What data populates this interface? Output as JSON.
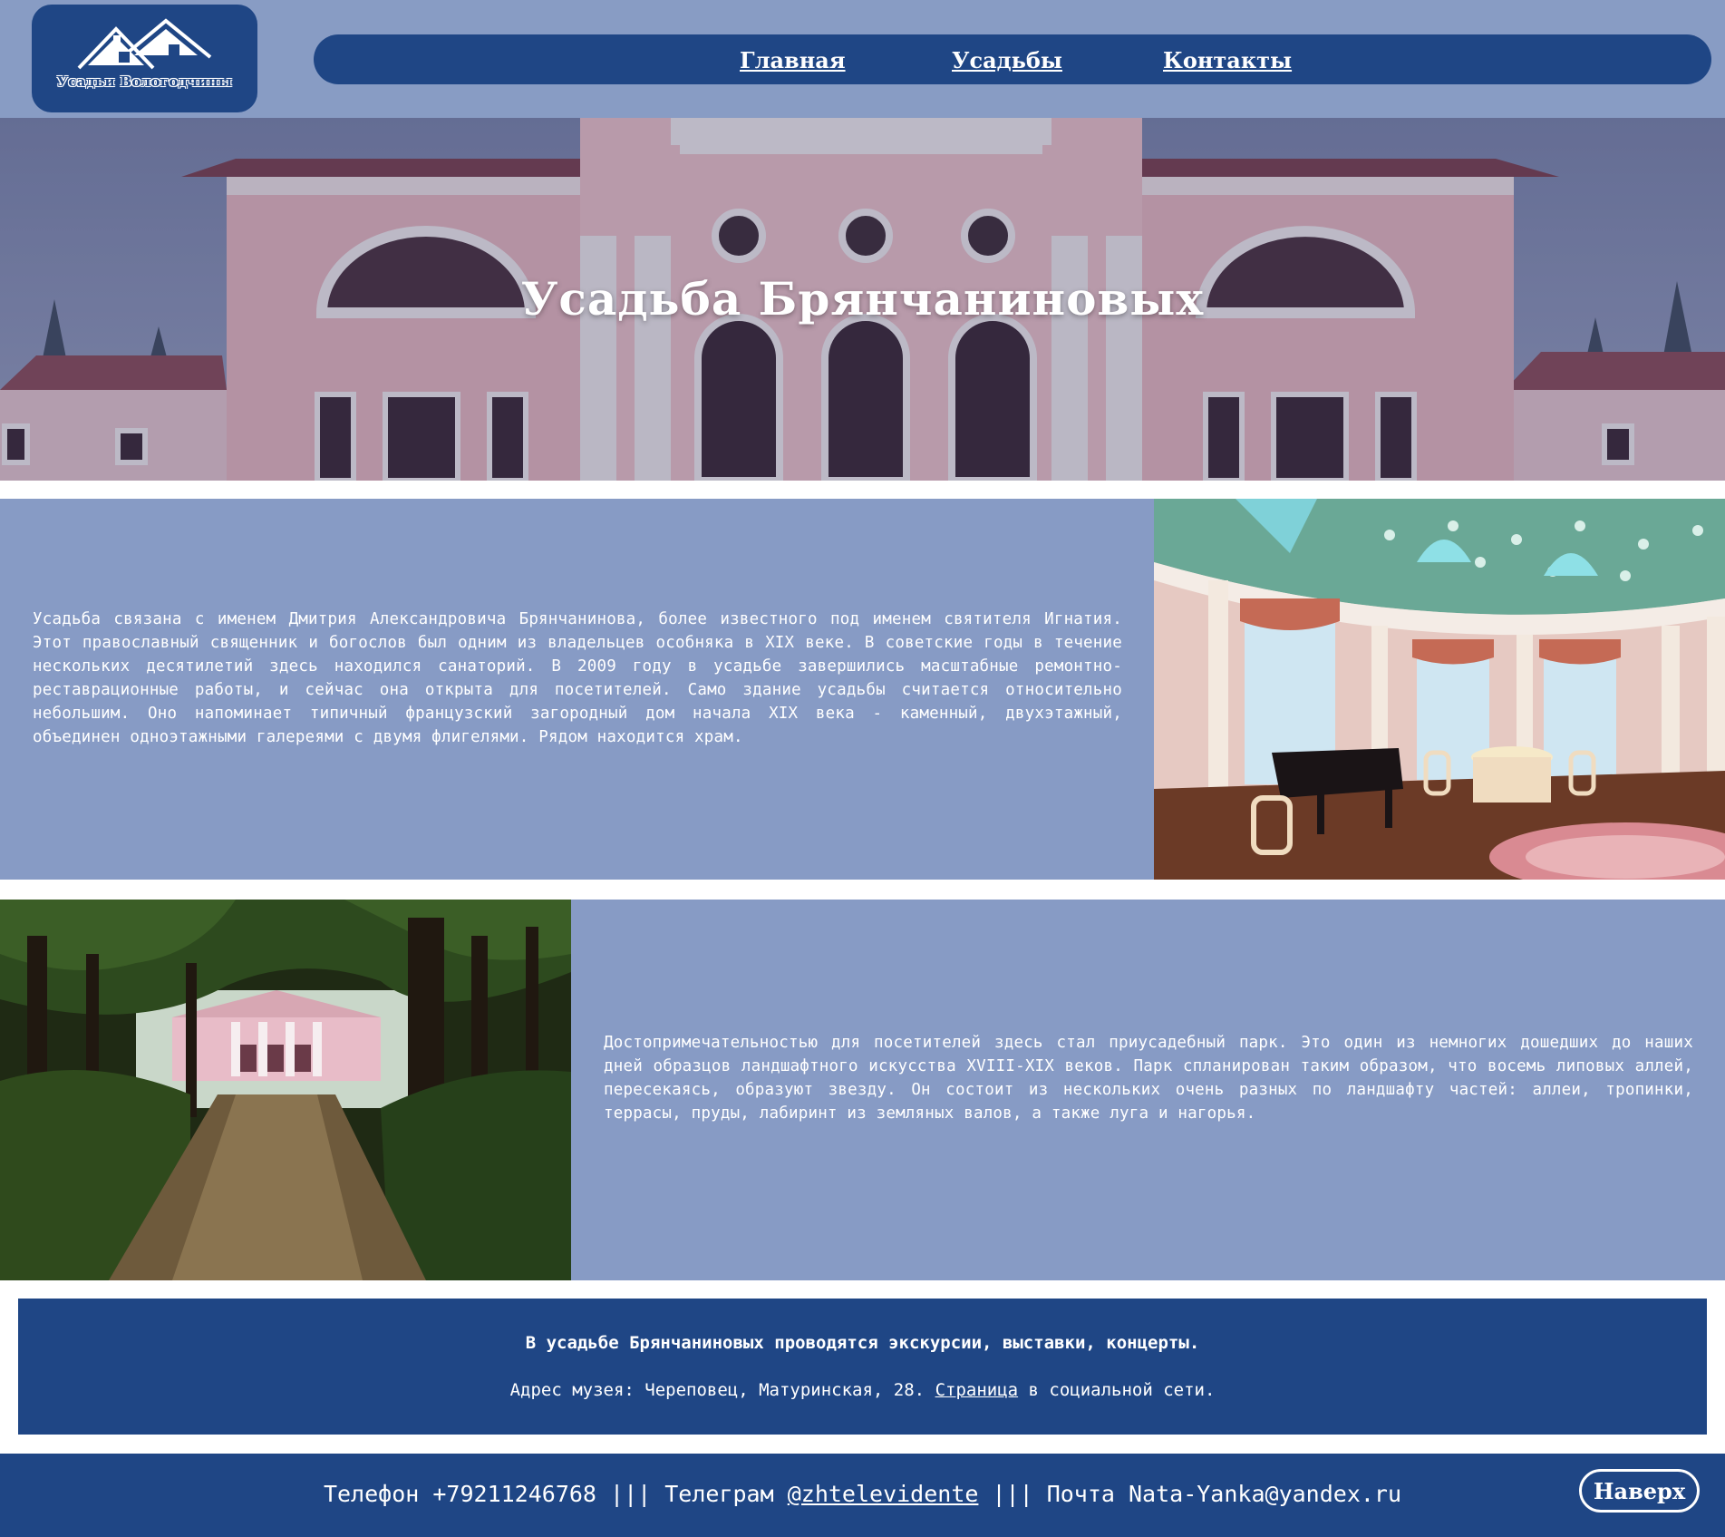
{
  "logo": {
    "text": "Усадьи Вологодчины"
  },
  "nav": {
    "items": [
      {
        "label": "Главная"
      },
      {
        "label": "Усадьбы"
      },
      {
        "label": "Контакты"
      }
    ]
  },
  "hero": {
    "title": "Усадьба Брянчаниновых"
  },
  "section1": {
    "text": "Усадьба связана с именем Дмитрия Александровича Брянчанинова, более известного под именем святителя Игнатия. Этот православный священник и богослов был одним из владельцев особняка в XIX веке. В советские годы в течение нескольких десятилетий здесь находился санаторий. В 2009 году в усадьбе завершились масштабные ремонтно-реставрационные работы, и сейчас она открыта для посетителей. Само здание усадьбы считается относительно небольшим. Оно напоминает типичный французский загородный дом начала XIX века - каменный, двухэтажный, объединен одноэтажными галереями с двумя флигелями. Рядом находится храм."
  },
  "section2": {
    "text": "Достопримечательностью для посетителей здесь стал приусадебный парк. Это один из немногих дошедших до наших дней образцов ландшафтного искусства XVIII-XIX веков. Парк спланирован таким образом, что восемь липовых аллей, пересекаясь, образуют звезду. Он состоит из нескольких очень разных по ландшафту частей: аллеи, тропинки, террасы, пруды, лабиринт из земляных валов, а также луга и нагорья."
  },
  "info": {
    "line1": "В усадьбе Брянчаниновых проводятся экскурсии, выставки, концерты.",
    "line2_prefix": "Адрес музея: Череповец, Матуринская, 28. ",
    "line2_link": "Страница",
    "line2_suffix": " в социальной сети."
  },
  "footer": {
    "phone": "Телефон +79211246768 ||| ",
    "telegram_label": "Телеграм ",
    "telegram_link": "@zhtelevidente",
    "mail": " ||| Почта Nata-Yanka@yandex.ru",
    "up_button": "Наверх"
  },
  "colors": {
    "dark_blue": "#1f4685",
    "light_blue": "#889cc4",
    "white": "#ffffff"
  }
}
